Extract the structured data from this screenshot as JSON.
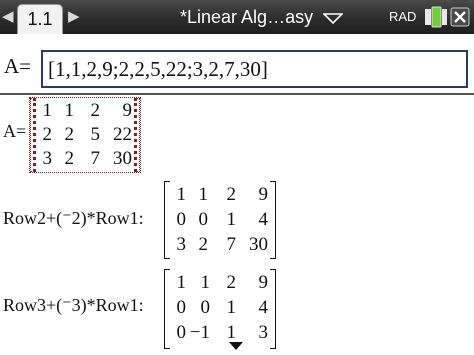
{
  "topbar": {
    "nav_left": "◀",
    "tab_label": "1.1",
    "nav_right": "▶",
    "doc_title": "*Linear Alg…asy",
    "angle_mode": "RAD"
  },
  "entry": {
    "label": "A=",
    "value": "[1,1,2,9;2,2,5,22;3,2,7,30]"
  },
  "history": [
    {
      "label": "A=",
      "rows": [
        [
          "1",
          "1",
          "2",
          "9"
        ],
        [
          "2",
          "2",
          "5",
          "22"
        ],
        [
          "3",
          "2",
          "7",
          "30"
        ]
      ]
    },
    {
      "label": "Row2+(⁻2)*Row1:",
      "rows": [
        [
          "1",
          "1",
          "2",
          "9"
        ],
        [
          "0",
          "0",
          "1",
          "4"
        ],
        [
          "3",
          "2",
          "7",
          "30"
        ]
      ]
    },
    {
      "label": "Row3+(⁻3)*Row1:",
      "rows": [
        [
          "1",
          "1",
          "2",
          "9"
        ],
        [
          "0",
          "0",
          "1",
          "4"
        ],
        [
          "0",
          "−1",
          "1",
          "3"
        ]
      ]
    }
  ]
}
